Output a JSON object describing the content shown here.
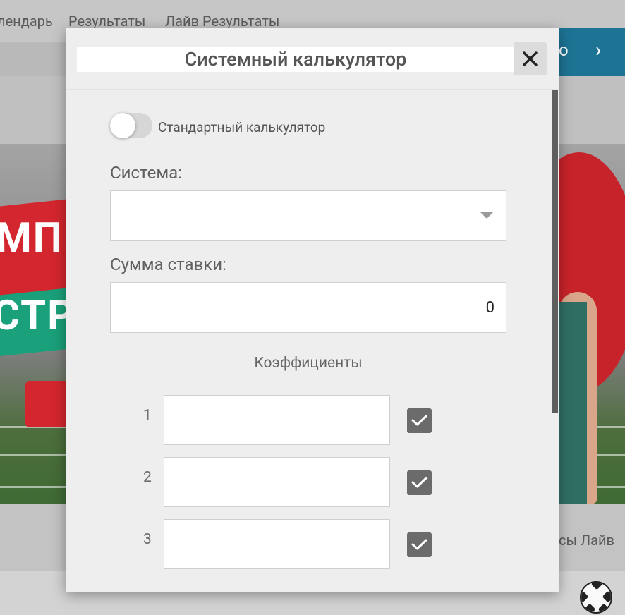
{
  "background": {
    "nav_items": [
      "лендарь",
      "Результаты",
      "Лайв Результаты"
    ],
    "banner_btn_text": "о",
    "banner_text_1": "МП",
    "banner_text_2": "СТР",
    "bottom_text": "сы Лайв"
  },
  "modal": {
    "title": "Системный калькулятор",
    "toggle_label": "Стандартный калькулятор",
    "system_label": "Система:",
    "system_value": "",
    "amount_label": "Сумма ставки:",
    "amount_value": "0",
    "coefficients_heading": "Коэффициенты",
    "rows": [
      {
        "num": "1",
        "value": "",
        "checked": true
      },
      {
        "num": "2",
        "value": "",
        "checked": true
      },
      {
        "num": "3",
        "value": "",
        "checked": true
      }
    ]
  },
  "colors": {
    "accent_blue": "#1d7394",
    "checkbox": "#6b6b6b",
    "modal_bg": "#eeeeee"
  }
}
